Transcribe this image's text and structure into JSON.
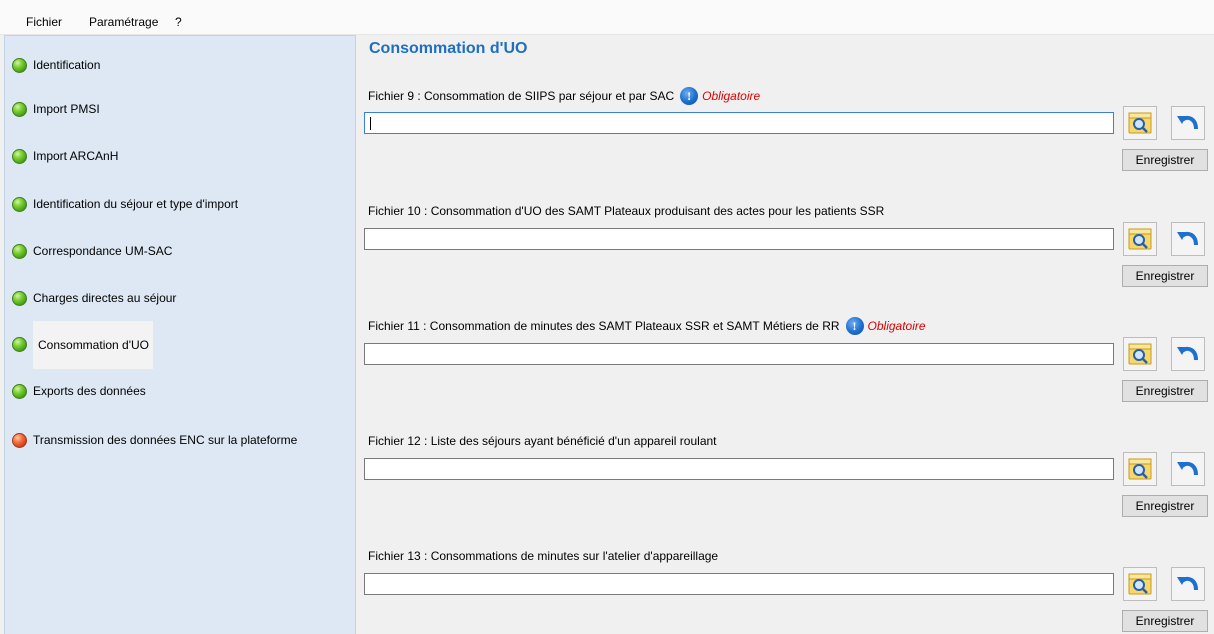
{
  "menu": {
    "fichier": "Fichier",
    "parametrage": "Paramétrage",
    "help": "?"
  },
  "sidebar": {
    "items": [
      {
        "label": "Identification",
        "status": "green"
      },
      {
        "label": "Import PMSI",
        "status": "green"
      },
      {
        "label": "Import ARCAnH",
        "status": "green"
      },
      {
        "label": "Identification du séjour et type d'import",
        "status": "green"
      },
      {
        "label": "Correspondance UM-SAC",
        "status": "green"
      },
      {
        "label": "Charges directes au séjour",
        "status": "green"
      },
      {
        "label": "Consommation d'UO",
        "status": "green",
        "selected": true
      },
      {
        "label": "Exports des données",
        "status": "green"
      },
      {
        "label": "Transmission des données ENC sur la plateforme",
        "status": "red"
      }
    ]
  },
  "main": {
    "title": "Consommation d'UO",
    "required_text": "Obligatoire",
    "info_glyph": "!",
    "save_label": "Enregistrer",
    "files": [
      {
        "label": "Fichier 9 : Consommation de SIIPS par séjour et par SAC",
        "required": true,
        "value": ""
      },
      {
        "label": "Fichier 10 : Consommation d'UO des SAMT Plateaux produisant des actes pour les patients SSR",
        "required": false,
        "value": ""
      },
      {
        "label": "Fichier 11 : Consommation de minutes des SAMT Plateaux SSR et SAMT Métiers de RR",
        "required": true,
        "value": ""
      },
      {
        "label": "Fichier 12 : Liste des séjours ayant bénéficié d'un appareil roulant",
        "required": false,
        "value": ""
      },
      {
        "label": "Fichier 13 : Consommations de minutes sur l'atelier d'appareillage",
        "required": false,
        "value": ""
      }
    ]
  },
  "colors": {
    "title_blue": "#1f6fc1",
    "sidebar_bg": "#dde8f4",
    "required_red": "#e00000",
    "status_green": "#4caf20",
    "status_red": "#e0502a"
  },
  "icons": {
    "browse": "folder-search-icon",
    "undo": "undo-arrow-icon",
    "info": "info-icon",
    "status": "status-dot-icon"
  }
}
